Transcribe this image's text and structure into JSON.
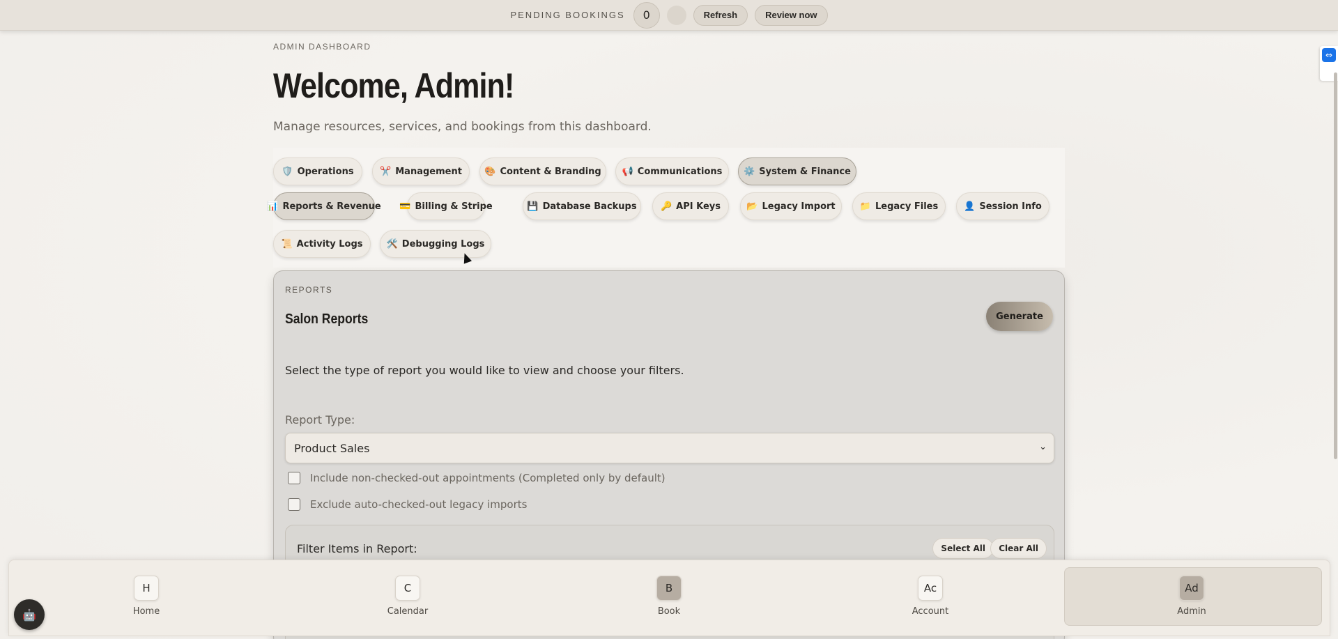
{
  "topbar": {
    "label": "PENDING BOOKINGS",
    "count": "0",
    "refresh_label": "Refresh",
    "review_label": "Review now"
  },
  "header": {
    "eyebrow": "ADMIN DASHBOARD",
    "title": "Welcome, Admin!",
    "subtitle": "Manage resources, services, and bookings from this dashboard."
  },
  "tabs": [
    {
      "icon": "🛡️",
      "label": "Operations",
      "icon_name": "shield-icon"
    },
    {
      "icon": "✂️",
      "label": "Management",
      "icon_name": "scissors-icon"
    },
    {
      "icon": "🎨",
      "label": "Content & Branding",
      "icon_name": "palette-icon"
    },
    {
      "icon": "📢",
      "label": "Communications",
      "icon_name": "megaphone-icon"
    },
    {
      "icon": "⚙️",
      "label": "System & Finance",
      "icon_name": "gear-icon",
      "active": true
    },
    {
      "icon": "📊",
      "label": "Reports & Revenue",
      "icon_name": "bar-chart-icon",
      "active": true
    },
    {
      "icon": "💳",
      "label": "Billing & Stripe",
      "icon_name": "credit-card-icon"
    },
    {
      "icon": "💾",
      "label": "Database Backups",
      "icon_name": "floppy-disk-icon"
    },
    {
      "icon": "🔑",
      "label": "API Keys",
      "icon_name": "key-icon"
    },
    {
      "icon": "📂",
      "label": "Legacy Import",
      "icon_name": "open-folder-icon"
    },
    {
      "icon": "📁",
      "label": "Legacy Files",
      "icon_name": "folder-icon"
    },
    {
      "icon": "👤",
      "label": "Session Info",
      "icon_name": "user-icon"
    },
    {
      "icon": "📜",
      "label": "Activity Logs",
      "icon_name": "scroll-icon"
    },
    {
      "icon": "🛠️",
      "label": "Debugging Logs",
      "icon_name": "tools-icon"
    }
  ],
  "reports": {
    "eyebrow": "REPORTS",
    "title": "Salon Reports",
    "generate_label": "Generate",
    "description": "Select the type of report you would like to view and choose your filters.",
    "report_type_label": "Report Type:",
    "report_type_value": "Product Sales",
    "checkbox_non_checked_out": "Include non-checked-out appointments (Completed only by default)",
    "checkbox_exclude_legacy": "Exclude auto-checked-out legacy imports",
    "filter_label": "Filter Items in Report:",
    "select_all_label": "Select All",
    "clear_all_label": "Clear All"
  },
  "bottom_nav": [
    {
      "abbr": "H",
      "label": "Home"
    },
    {
      "abbr": "C",
      "label": "Calendar"
    },
    {
      "abbr": "B",
      "label": "Book"
    },
    {
      "abbr": "Ac",
      "label": "Account"
    },
    {
      "abbr": "Ad",
      "label": "Admin",
      "active": true
    }
  ],
  "colors": {
    "accent": "#8a8175",
    "panel_bg": "#dcdad7",
    "topbar_bg": "#e7e2db"
  }
}
